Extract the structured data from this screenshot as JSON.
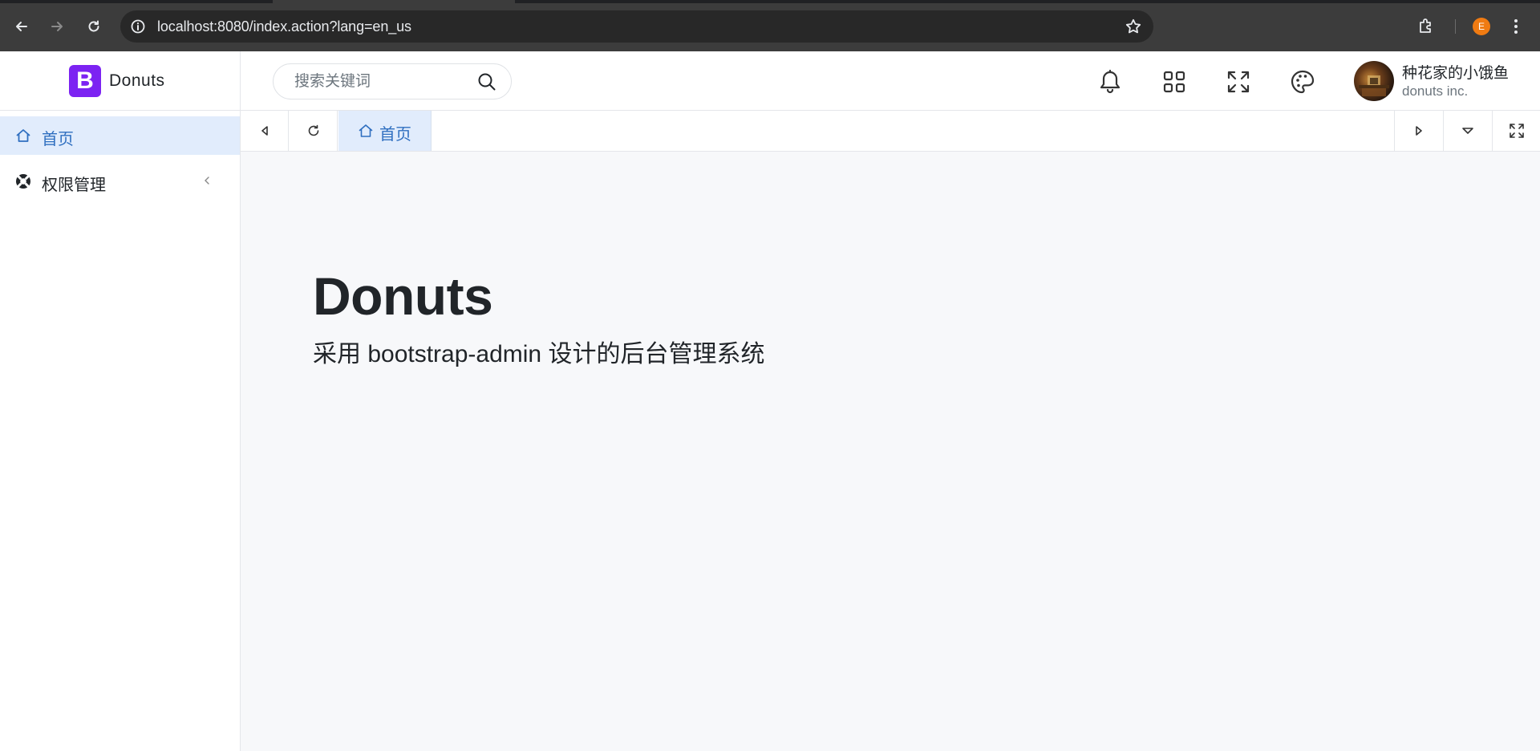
{
  "browser": {
    "url": "localhost:8080/index.action?lang=en_us",
    "profile_initial": "E"
  },
  "brand": {
    "logo_letter": "B",
    "name": "Donuts",
    "color": "#7c23f2"
  },
  "sidebar": {
    "items": [
      {
        "label": "首页",
        "icon": "home-icon",
        "active": true
      },
      {
        "label": "权限管理",
        "icon": "lifebuoy-icon",
        "active": false
      }
    ]
  },
  "header": {
    "search_placeholder": "搜索关键词",
    "icons": [
      "bell-icon",
      "apps-grid-icon",
      "fullscreen-icon",
      "palette-icon"
    ],
    "user": {
      "name": "种花家的小饿鱼",
      "org": "donuts inc."
    }
  },
  "tabs": [
    {
      "label": "首页",
      "icon": "home-icon",
      "active": true
    }
  ],
  "main": {
    "title": "Donuts",
    "subtitle": "采用 bootstrap-admin 设计的后台管理系统"
  },
  "colors": {
    "accent": "#2f6fc0",
    "active_bg": "#e1ecfc",
    "content_bg": "#f7f8fa"
  }
}
